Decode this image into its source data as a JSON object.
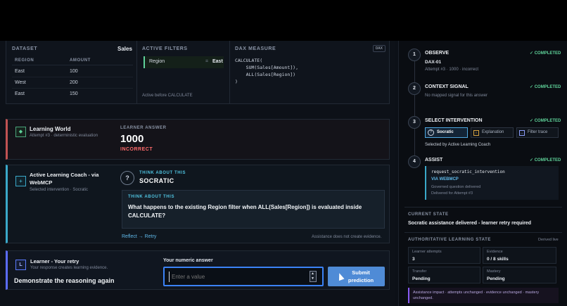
{
  "dataset": {
    "caption": "DATASET",
    "name": "Sales",
    "headers": [
      "REGION",
      "AMOUNT"
    ],
    "rows": [
      {
        "region": "East",
        "amount": "100"
      },
      {
        "region": "West",
        "amount": "200"
      },
      {
        "region": "East",
        "amount": "150"
      }
    ]
  },
  "filters": {
    "caption": "ACTIVE FILTERS",
    "filter_field": "Region",
    "filter_op": "=",
    "filter_value": "East",
    "note": "Active before CALCULATE"
  },
  "measure": {
    "caption": "DAX MEASURE",
    "badge": "DAX",
    "lines": [
      "CALCULATE(",
      "    SUM(Sales[Amount]),",
      "    ALL(Sales[Region])",
      ")"
    ]
  },
  "world": {
    "title": "Learning World",
    "subtitle": "Attempt #3 · deterministic evaluation",
    "answer_caption": "LEARNER ANSWER",
    "answer": "1000",
    "verdict": "INCORRECT"
  },
  "coach": {
    "title": "Active Learning Coach - via WebMCP",
    "subtitle": "Selected intervention · Socratic",
    "prompt_caption": "THINK ABOUT THIS",
    "mode": "SOCRATIC",
    "question_caption": "THINK ABOUT THIS",
    "question": "What happens to the existing Region filter when ALL(Sales[Region]) is evaluated inside CALCULATE?",
    "link": "Reflect → Retry",
    "note": "Assistance does not create evidence."
  },
  "retry": {
    "badge": "L",
    "title": "Learner - Your retry",
    "subtitle": "Your response creates learning evidence.",
    "cta": "Demonstrate the reasoning again",
    "input_label": "Your numeric answer",
    "placeholder": "Enter a value",
    "submit": "Submit prediction"
  },
  "steps": [
    {
      "num": "1",
      "title": "OBSERVE",
      "status": "✓ COMPLETED",
      "line1": "DAX-01",
      "line2": "Attempt #3 · 1000 · incorrect"
    },
    {
      "num": "2",
      "title": "CONTEXT SIGNAL",
      "status": "✓ COMPLETED",
      "line1": "No mapped signal for this answer"
    },
    {
      "num": "3",
      "title": "SELECT INTERVENTION",
      "status": "✓ COMPLETED",
      "options": [
        "Socratic",
        "Explanation",
        "Filter trace"
      ],
      "line1": "Selected by Active Learning Coach"
    },
    {
      "num": "4",
      "title": "ASSIST",
      "status": "✓ COMPLETED",
      "fn": "request_socratic_intervention",
      "via": "VIA WEBMCP",
      "line1": "Governed question delivered",
      "line2": "Delivered for Attempt #3"
    }
  ],
  "current_state": {
    "caption": "CURRENT STATE",
    "text": "Socratic assistance delivered - learner retry required"
  },
  "auth_state": {
    "caption": "AUTHORITATIVE LEARNING STATE",
    "live": "Derived live",
    "cells": [
      {
        "label": "Learner attempts",
        "value": "3"
      },
      {
        "label": "Evidence",
        "value": "0 / 8 skills"
      },
      {
        "label": "Transfer",
        "value": "Pending"
      },
      {
        "label": "Mastery",
        "value": "Pending"
      }
    ],
    "impact": "Assistance impact · attempts unchanged · evidence unchanged · mastery unchanged."
  },
  "colors": {
    "accent": "#3b82f6",
    "success": "#5fd39a",
    "danger": "#ff6b6b",
    "teal": "#4fc3e0"
  }
}
